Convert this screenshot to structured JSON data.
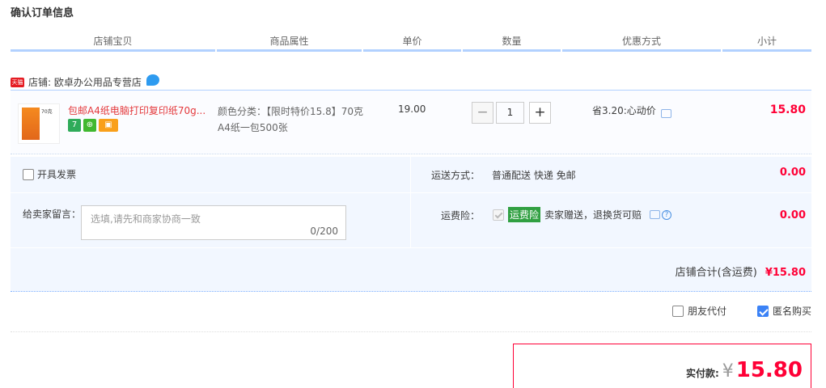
{
  "page_title": "确认订单信息",
  "columns": [
    "店铺宝贝",
    "商品属性",
    "单价",
    "数量",
    "优惠方式",
    "小计"
  ],
  "shop": {
    "tmall_badge": "天猫",
    "label": "店铺: 欧卓办公用品专营店"
  },
  "item": {
    "thumb_text": "70克",
    "title": "包邮A4纸电脑打印复印纸70g...",
    "badges": [
      "7",
      "⊕",
      "▣"
    ],
    "attribute": "颜色分类：【限时特价15.8】70克A4纸一包500张",
    "unit_price": "19.00",
    "quantity": "1",
    "minus": "−",
    "plus": "+",
    "promo": "省3.20:心动价",
    "subtotal": "15.80"
  },
  "invoice_label": "开具发票",
  "shipping": {
    "label": "运送方式：",
    "value": "普通配送 快递 免邮",
    "price": "0.00"
  },
  "message": {
    "label": "给卖家留言：",
    "placeholder": "选填,请先和商家协商一致",
    "count": "0/200"
  },
  "insurance": {
    "label": "运费险：",
    "badge": "运费险",
    "text": "卖家赠送，退换货可赔",
    "help": "?",
    "price": "0.00"
  },
  "shop_total": {
    "label": "店铺合计(含运费)",
    "value": "¥15.80"
  },
  "options": {
    "friend_pay": "朋友代付",
    "anonymous": "匿名购买"
  },
  "payment": {
    "label": "实付款:",
    "currency": "¥",
    "value": "15.80"
  }
}
